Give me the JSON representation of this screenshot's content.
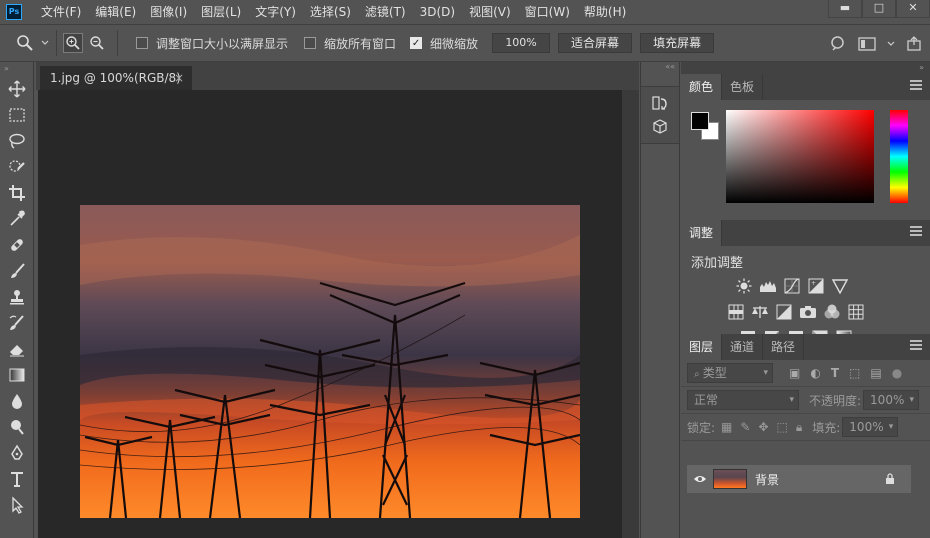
{
  "app": {
    "logo": "Ps",
    "menu": [
      "文件(F)",
      "编辑(E)",
      "图像(I)",
      "图层(L)",
      "文字(Y)",
      "选择(S)",
      "滤镜(T)",
      "3D(D)",
      "视图(V)",
      "窗口(W)",
      "帮助(H)"
    ],
    "window_controls": {
      "minimize": "▬",
      "maximize": "□",
      "close": "✕"
    }
  },
  "options_bar": {
    "resize_windows_label": "调整窗口大小以满屏显示",
    "zoom_all_label": "缩放所有窗口",
    "scrubby_zoom_label": "细微缩放",
    "scrubby_zoom_checked": true,
    "zoom_value": "100%",
    "fit_screen_label": "适合屏幕",
    "fill_screen_label": "填充屏幕"
  },
  "document": {
    "tab_title": "1.jpg @ 100%(RGB/8)",
    "tab_close": "×"
  },
  "panels": {
    "color_tabs": [
      "颜色",
      "色板"
    ],
    "adjustments_tab": "调整",
    "adjustments_title": "添加调整",
    "layers_tabs": [
      "图层",
      "通道",
      "路径"
    ],
    "layers": {
      "filter_kind": "类型",
      "blend_mode": "正常",
      "opacity_label": "不透明度:",
      "opacity_value": "100%",
      "lock_label": "锁定:",
      "fill_label": "填充:",
      "fill_value": "100%",
      "items": [
        {
          "name": "背景",
          "visible": true,
          "locked": true
        }
      ]
    },
    "foreground_color": "#000000",
    "background_color": "#ffffff"
  }
}
